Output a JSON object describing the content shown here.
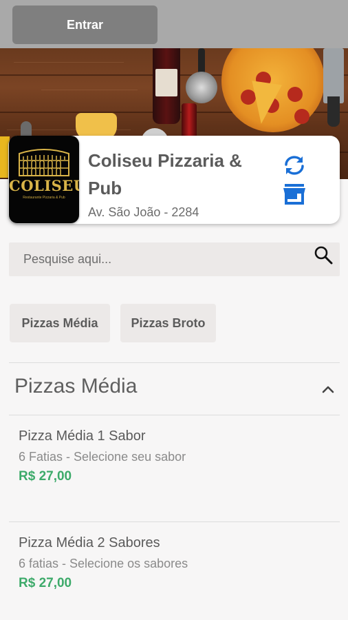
{
  "header": {
    "login_label": "Entrar"
  },
  "store": {
    "logo_text": "COLISEU",
    "logo_subtitle": "Restaurante Pizzaria & Pub",
    "name": "Coliseu Pizzaria & Pub",
    "address": "Av. São João - 2284",
    "icons": {
      "refresh": "refresh-icon",
      "store": "storefront-icon"
    }
  },
  "search": {
    "placeholder": "Pesquise aqui...",
    "value": "",
    "icon": "search-icon"
  },
  "categories": [
    {
      "label": "Pizzas Média"
    },
    {
      "label": "Pizzas Broto"
    }
  ],
  "section": {
    "title": "Pizzas Média",
    "expanded": true,
    "icon": "chevron-up-icon"
  },
  "products": [
    {
      "name": "Pizza Média 1 Sabor",
      "description": "6 Fatias - Selecione seu sabor",
      "price": "R$ 27,00"
    },
    {
      "name": "Pizza Média 2 Sabores",
      "description": "6 fatias - Selecione os sabores",
      "price": "R$ 27,00"
    }
  ],
  "colors": {
    "accent": "#1a6fd6",
    "price": "#3daa6a",
    "topbar": "#a9a9a9",
    "login_button": "#7f7f7f"
  }
}
